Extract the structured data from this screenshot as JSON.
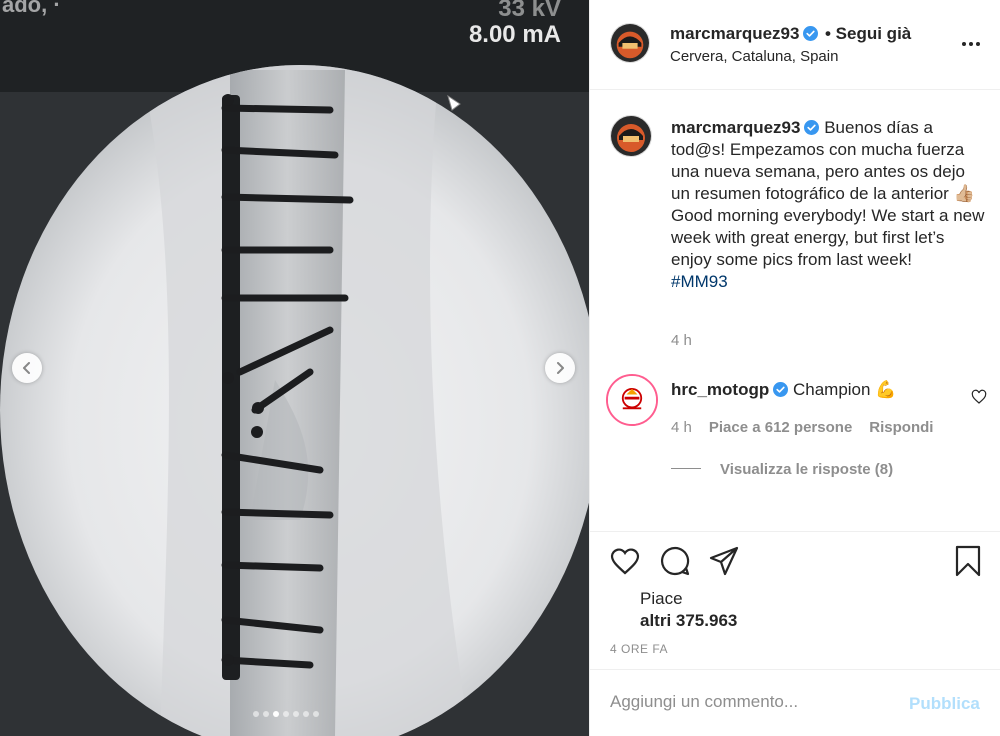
{
  "media": {
    "monitor_text_kv": "33 kV",
    "monitor_text_ma": "8.00 mA",
    "monitor_text_left": "ado, ·",
    "carousel_dots": 7,
    "carousel_active_index": 3,
    "prev_icon": "chevron-left-icon",
    "next_icon": "chevron-right-icon"
  },
  "header": {
    "username": "marcmarquez93",
    "follow_label": "• Segui già",
    "location": "Cervera, Cataluna, Spain",
    "more_icon": "more-options-icon"
  },
  "caption": {
    "username": "marcmarquez93",
    "text_es": "Buenos días a tod@s! Empezamos con mucha fuerza una nueva semana, pero antes os dejo un resumen fotográfico de la anterior 👍🏼",
    "text_en": "Good morning everybody! We start a new week with great energy, but first let’s enjoy some pics from last week!",
    "hashtag": "#MM93",
    "time": "4 h"
  },
  "comment": {
    "username": "hrc_motogp",
    "text": "Champion 💪",
    "time": "4 h",
    "likes_label": "Piace a 612 persone",
    "reply_label": "Rispondi",
    "view_replies_label": "Visualizza le risposte (8)"
  },
  "actions": {
    "likes_prefix": "Piace",
    "likes_count": "altri 375.963",
    "post_time": "4 ORE FA"
  },
  "add_comment": {
    "placeholder": "Aggiungi un commento...",
    "publish_label": "Pubblica"
  },
  "colors": {
    "verified": "#3897f0",
    "hashtag": "#00376b",
    "publish_disabled": "#b2dffc",
    "secondary_text": "#8e8e8e"
  }
}
